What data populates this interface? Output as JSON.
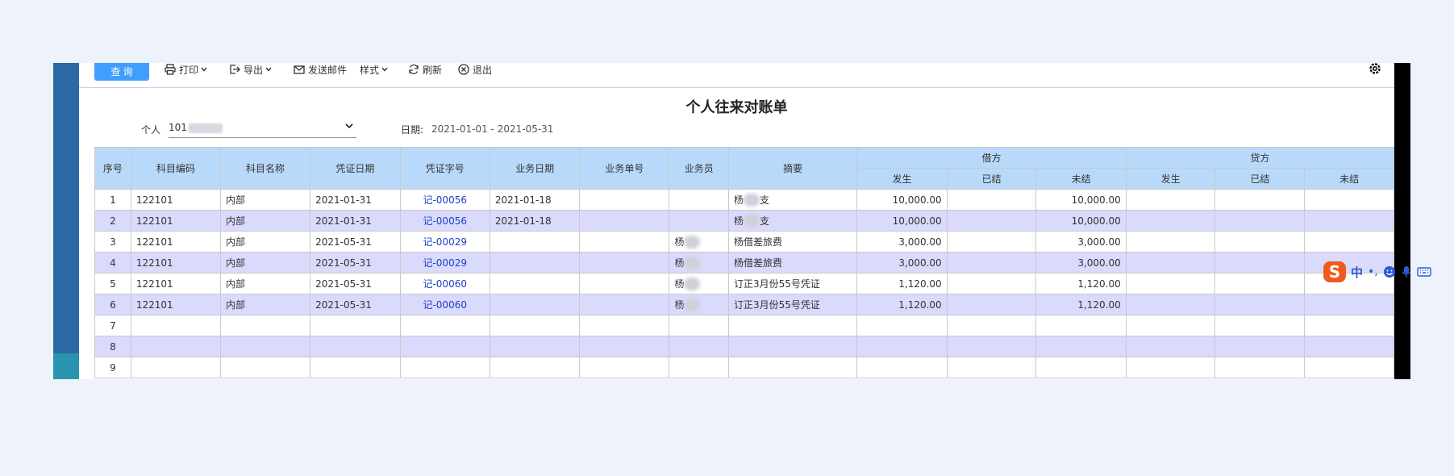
{
  "toolbar": {
    "query": "查 询",
    "print": "打印",
    "export": "导出",
    "send_mail": "发送邮件",
    "style": "样式",
    "refresh": "刷新",
    "exit": "退出"
  },
  "report": {
    "title": "个人往来对账单",
    "person_label": "个人",
    "person_value": "101",
    "date_label": "日期:",
    "date_range": "2021-01-01 - 2021-05-31"
  },
  "table": {
    "headers": {
      "seq": "序号",
      "account_code": "科目编码",
      "account_name": "科目名称",
      "voucher_date": "凭证日期",
      "voucher_no": "凭证字号",
      "biz_date": "业务日期",
      "biz_no": "业务单号",
      "clerk": "业务员",
      "summary": "摘要",
      "debit": "借方",
      "credit": "贷方",
      "occur": "发生",
      "settled": "已结",
      "unsettled": "未结"
    },
    "rows": [
      {
        "seq": "1",
        "code": "122101",
        "name": "内部",
        "vdate": "2021-01-31",
        "vno": "记-00056",
        "bdate": "2021-01-18",
        "bno": "",
        "clerk": "",
        "summary_a": "杨",
        "summary_b": "支",
        "d_occur": "10,000.00",
        "d_settled": "",
        "d_unsettled": "10,000.00"
      },
      {
        "seq": "2",
        "code": "122101",
        "name": "内部",
        "vdate": "2021-01-31",
        "vno": "记-00056",
        "bdate": "2021-01-18",
        "bno": "",
        "clerk": "",
        "summary_a": "杨",
        "summary_b": "支",
        "d_occur": "10,000.00",
        "d_settled": "",
        "d_unsettled": "10,000.00"
      },
      {
        "seq": "3",
        "code": "122101",
        "name": "内部",
        "vdate": "2021-05-31",
        "vno": "记-00029",
        "bdate": "",
        "bno": "",
        "clerk": "杨",
        "summary_a": "杨借差旅费",
        "summary_b": "",
        "d_occur": "3,000.00",
        "d_settled": "",
        "d_unsettled": "3,000.00"
      },
      {
        "seq": "4",
        "code": "122101",
        "name": "内部",
        "vdate": "2021-05-31",
        "vno": "记-00029",
        "bdate": "",
        "bno": "",
        "clerk": "杨",
        "summary_a": "杨借差旅费",
        "summary_b": "",
        "d_occur": "3,000.00",
        "d_settled": "",
        "d_unsettled": "3,000.00"
      },
      {
        "seq": "5",
        "code": "122101",
        "name": "内部",
        "vdate": "2021-05-31",
        "vno": "记-00060",
        "bdate": "",
        "bno": "",
        "clerk": "杨",
        "summary_a": "订正3月份55号凭证",
        "summary_b": "",
        "d_occur": "1,120.00",
        "d_settled": "",
        "d_unsettled": "1,120.00"
      },
      {
        "seq": "6",
        "code": "122101",
        "name": "内部",
        "vdate": "2021-05-31",
        "vno": "记-00060",
        "bdate": "",
        "bno": "",
        "clerk": "杨",
        "summary_a": "订正3月份55号凭证",
        "summary_b": "",
        "d_occur": "1,120.00",
        "d_settled": "",
        "d_unsettled": "1,120.00"
      },
      {
        "seq": "7"
      },
      {
        "seq": "8"
      },
      {
        "seq": "9"
      }
    ]
  },
  "ime": {
    "logo": "S",
    "mode": "中",
    "punct": "•,"
  }
}
